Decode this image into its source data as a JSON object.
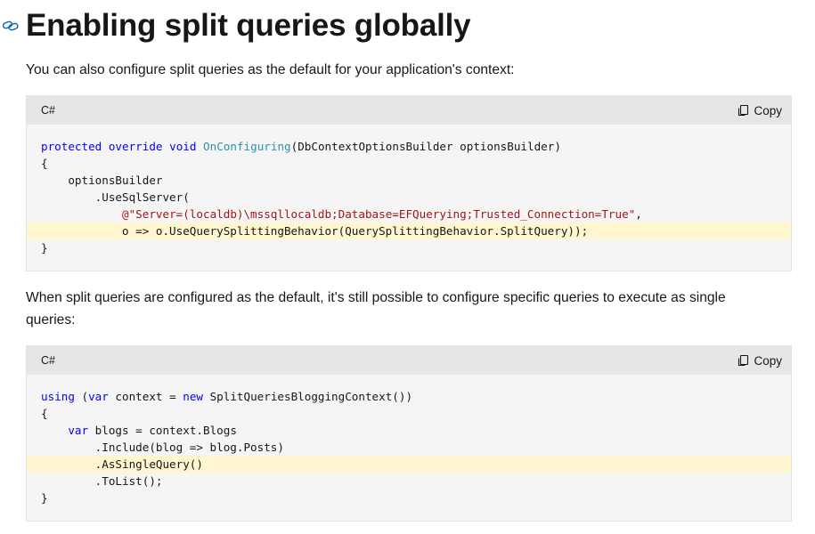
{
  "heading": {
    "title": "Enabling split queries globally",
    "anchor_icon": "link-icon"
  },
  "paragraphs": {
    "intro": "You can also configure split queries as the default for your application's context:",
    "second": "When split queries are configured as the default, it's still possible to configure specific queries to execute as single queries:"
  },
  "code_blocks": [
    {
      "language": "C#",
      "copy_label": "Copy",
      "lines": [
        {
          "highlight": false,
          "tokens": [
            {
              "t": "protected",
              "c": "kw"
            },
            {
              "t": " "
            },
            {
              "t": "override",
              "c": "kw"
            },
            {
              "t": " "
            },
            {
              "t": "void",
              "c": "kw"
            },
            {
              "t": " "
            },
            {
              "t": "OnConfiguring",
              "c": "fn"
            },
            {
              "t": "(DbContextOptionsBuilder optionsBuilder)"
            }
          ]
        },
        {
          "highlight": false,
          "tokens": [
            {
              "t": "{"
            }
          ]
        },
        {
          "highlight": false,
          "tokens": [
            {
              "t": "    optionsBuilder"
            }
          ]
        },
        {
          "highlight": false,
          "tokens": [
            {
              "t": "        .UseSqlServer("
            }
          ]
        },
        {
          "highlight": false,
          "tokens": [
            {
              "t": "            "
            },
            {
              "t": "@\"Server=(localdb)\\mssqllocaldb;Database=EFQuerying;Trusted_Connection=True\"",
              "c": "str"
            },
            {
              "t": ","
            }
          ]
        },
        {
          "highlight": true,
          "tokens": [
            {
              "t": "            o => o.UseQuerySplittingBehavior(QuerySplittingBehavior.SplitQuery));"
            }
          ]
        },
        {
          "highlight": false,
          "tokens": [
            {
              "t": "}"
            }
          ]
        }
      ]
    },
    {
      "language": "C#",
      "copy_label": "Copy",
      "lines": [
        {
          "highlight": false,
          "tokens": [
            {
              "t": "using",
              "c": "kw"
            },
            {
              "t": " ("
            },
            {
              "t": "var",
              "c": "kw"
            },
            {
              "t": " context = "
            },
            {
              "t": "new",
              "c": "kw"
            },
            {
              "t": " SplitQueriesBloggingContext())"
            }
          ]
        },
        {
          "highlight": false,
          "tokens": [
            {
              "t": "{"
            }
          ]
        },
        {
          "highlight": false,
          "tokens": [
            {
              "t": "    "
            },
            {
              "t": "var",
              "c": "kw"
            },
            {
              "t": " blogs = context.Blogs"
            }
          ]
        },
        {
          "highlight": false,
          "tokens": [
            {
              "t": "        .Include(blog => blog.Posts)"
            }
          ]
        },
        {
          "highlight": true,
          "tokens": [
            {
              "t": "        .AsSingleQuery()"
            }
          ]
        },
        {
          "highlight": false,
          "tokens": [
            {
              "t": "        .ToList();"
            }
          ]
        },
        {
          "highlight": false,
          "tokens": [
            {
              "t": "}"
            }
          ]
        }
      ]
    }
  ],
  "colors": {
    "keyword": "#0101fd",
    "type": "#2b91af",
    "string": "#a31515",
    "highlight": "#fff5ce",
    "code_bg": "#f5f5f5",
    "header_bg": "#e6e6e6"
  }
}
